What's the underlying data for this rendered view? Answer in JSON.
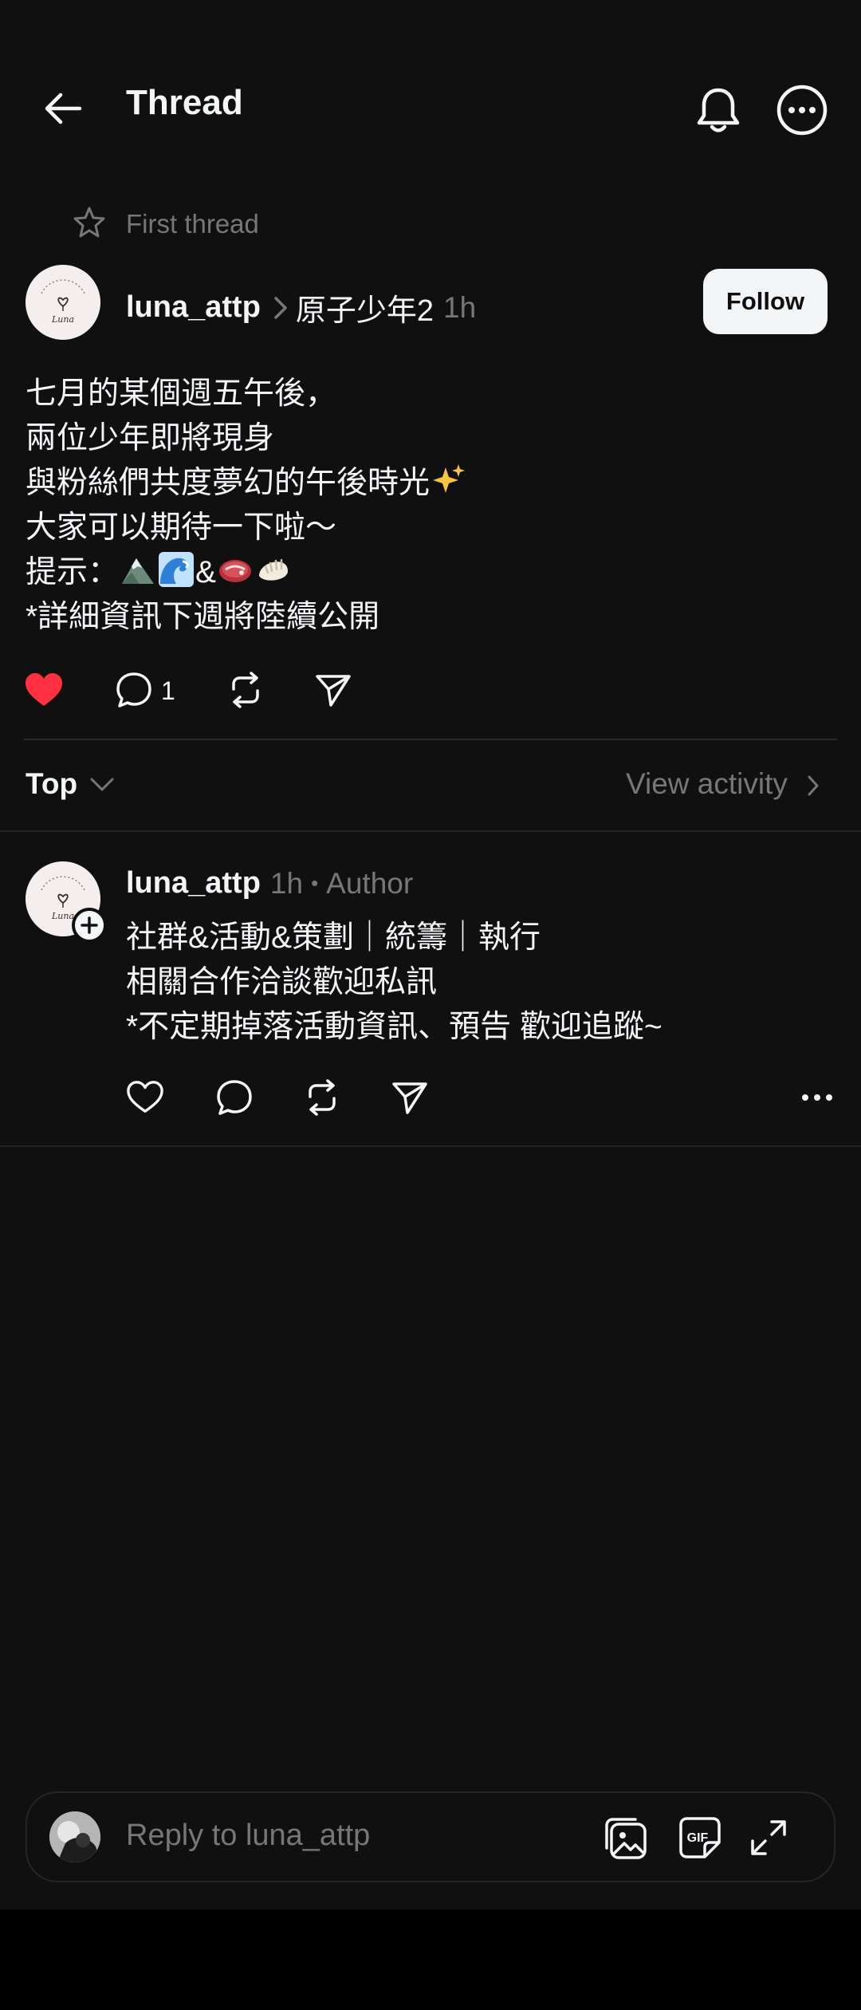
{
  "header": {
    "title": "Thread"
  },
  "first_thread_label": "First thread",
  "post": {
    "username": "luna_attp",
    "topic": "原子少年2",
    "time": "1h",
    "follow_label": "Follow",
    "avatar_text": "Luna",
    "lines": [
      "七月的某個週五午後，",
      "兩位少年即將現身",
      "與粉絲們共度夢幻的午後時光",
      "大家可以期待一下啦～",
      "提示：",
      "*詳細資訊下週將陸續公開"
    ],
    "hint_symbol": "&",
    "liked": true,
    "comment_count": "1"
  },
  "sort": {
    "label": "Top",
    "view_activity_label": "View activity"
  },
  "reply": {
    "username": "luna_attp",
    "time": "1h",
    "separator": "•",
    "author_label": "Author",
    "lines": [
      "社群&活動&策劃｜統籌｜執行",
      "相關合作洽談歡迎私訊",
      "*不定期掉落活動資訊、預告 歡迎追蹤~"
    ]
  },
  "composer": {
    "placeholder": "Reply to luna_attp",
    "gif_label": "GIF"
  },
  "colors": {
    "background": "#101010",
    "text": "#f3f5f7",
    "muted": "#777777",
    "like": "#ff3040",
    "divider": "#262626"
  }
}
